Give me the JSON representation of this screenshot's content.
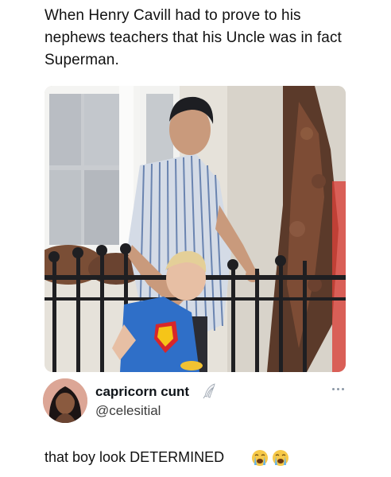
{
  "caption": {
    "text": "When Henry Cavill had to prove to his nephews teachers that his Uncle was in fact Superman."
  },
  "post": {
    "display_name": "capricorn cunt",
    "handle": "@celesitial",
    "text": "that boy look DETERMINED",
    "verified_icon": "white-quill-badge-icon",
    "more_icon": "more-options-icon",
    "emojis": [
      "crying-face-emoji",
      "crying-face-emoji"
    ]
  },
  "colors": {
    "text": "#0f1419",
    "secondary_text": "#3b3b3b",
    "background": "#ffffff",
    "superman_shirt": "#2f6fc8"
  }
}
